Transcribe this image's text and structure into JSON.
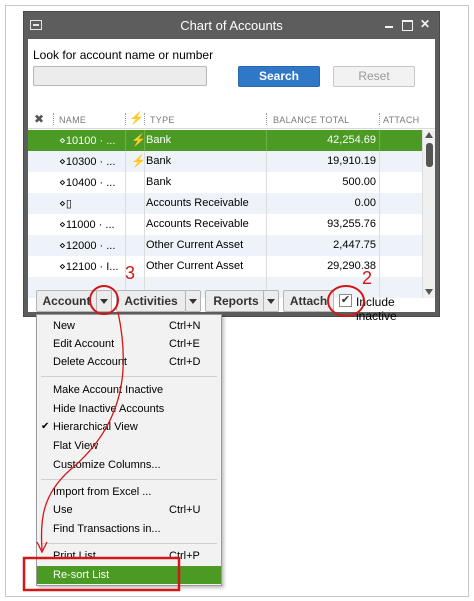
{
  "window": {
    "title": "Chart of Accounts"
  },
  "search": {
    "label": "Look for account name or number",
    "input_value": "",
    "search_label": "Search",
    "reset_label": "Reset"
  },
  "table": {
    "headers": {
      "name": "NAME",
      "type": "TYPE",
      "balance": "BALANCE TOTAL",
      "attach": "ATTACH"
    },
    "rows": [
      {
        "name": "⋄10100 · ...",
        "online": true,
        "type": "Bank",
        "balance": "42,254.69",
        "attach": ""
      },
      {
        "name": "⋄10300 · ...",
        "online": true,
        "type": "Bank",
        "balance": "19,910.19",
        "attach": ""
      },
      {
        "name": "⋄10400 · ...",
        "online": false,
        "type": "Bank",
        "balance": "500.00",
        "attach": ""
      },
      {
        "name": "⋄▯",
        "online": false,
        "type": "Accounts Receivable",
        "balance": "0.00",
        "attach": ""
      },
      {
        "name": "⋄11000 · ...",
        "online": false,
        "type": "Accounts Receivable",
        "balance": "93,255.76",
        "attach": ""
      },
      {
        "name": "⋄12000 · ...",
        "online": false,
        "type": "Other Current Asset",
        "balance": "2,447.75",
        "attach": ""
      },
      {
        "name": "⋄12100 · I...",
        "online": false,
        "type": "Other Current Asset",
        "balance": "29,290.38",
        "attach": ""
      }
    ],
    "selected_row": 0
  },
  "toolbar": {
    "account_label": "Account",
    "activities_label": "Activities",
    "reports_label": "Reports",
    "attach_label": "Attach",
    "include_inactive_label": "Include inactive",
    "include_inactive_checked": "✔"
  },
  "menu": {
    "items": [
      {
        "label": "New",
        "shortcut": "Ctrl+N"
      },
      {
        "label": "Edit Account",
        "shortcut": "Ctrl+E"
      },
      {
        "label": "Delete Account",
        "shortcut": "Ctrl+D"
      },
      {
        "label": "Make Account Inactive",
        "shortcut": ""
      },
      {
        "label": "Hide Inactive Accounts",
        "shortcut": ""
      },
      {
        "label": "Hierarchical View",
        "shortcut": "",
        "checked": "✔"
      },
      {
        "label": "Flat View",
        "shortcut": ""
      },
      {
        "label": "Customize Columns...",
        "shortcut": ""
      },
      {
        "label": "Import from Excel ...",
        "shortcut": ""
      },
      {
        "label": "Use",
        "shortcut": "Ctrl+U"
      },
      {
        "label": "Find Transactions in...",
        "shortcut": ""
      },
      {
        "label": "Print List...",
        "shortcut": "Ctrl+P"
      },
      {
        "label": "Re-sort List",
        "shortcut": ""
      }
    ]
  },
  "annotations": {
    "step2": "2",
    "step3": "3"
  },
  "colors": {
    "highlight": "#4a9a24",
    "annotation": "#d01818",
    "search_button": "#2f78c8"
  }
}
